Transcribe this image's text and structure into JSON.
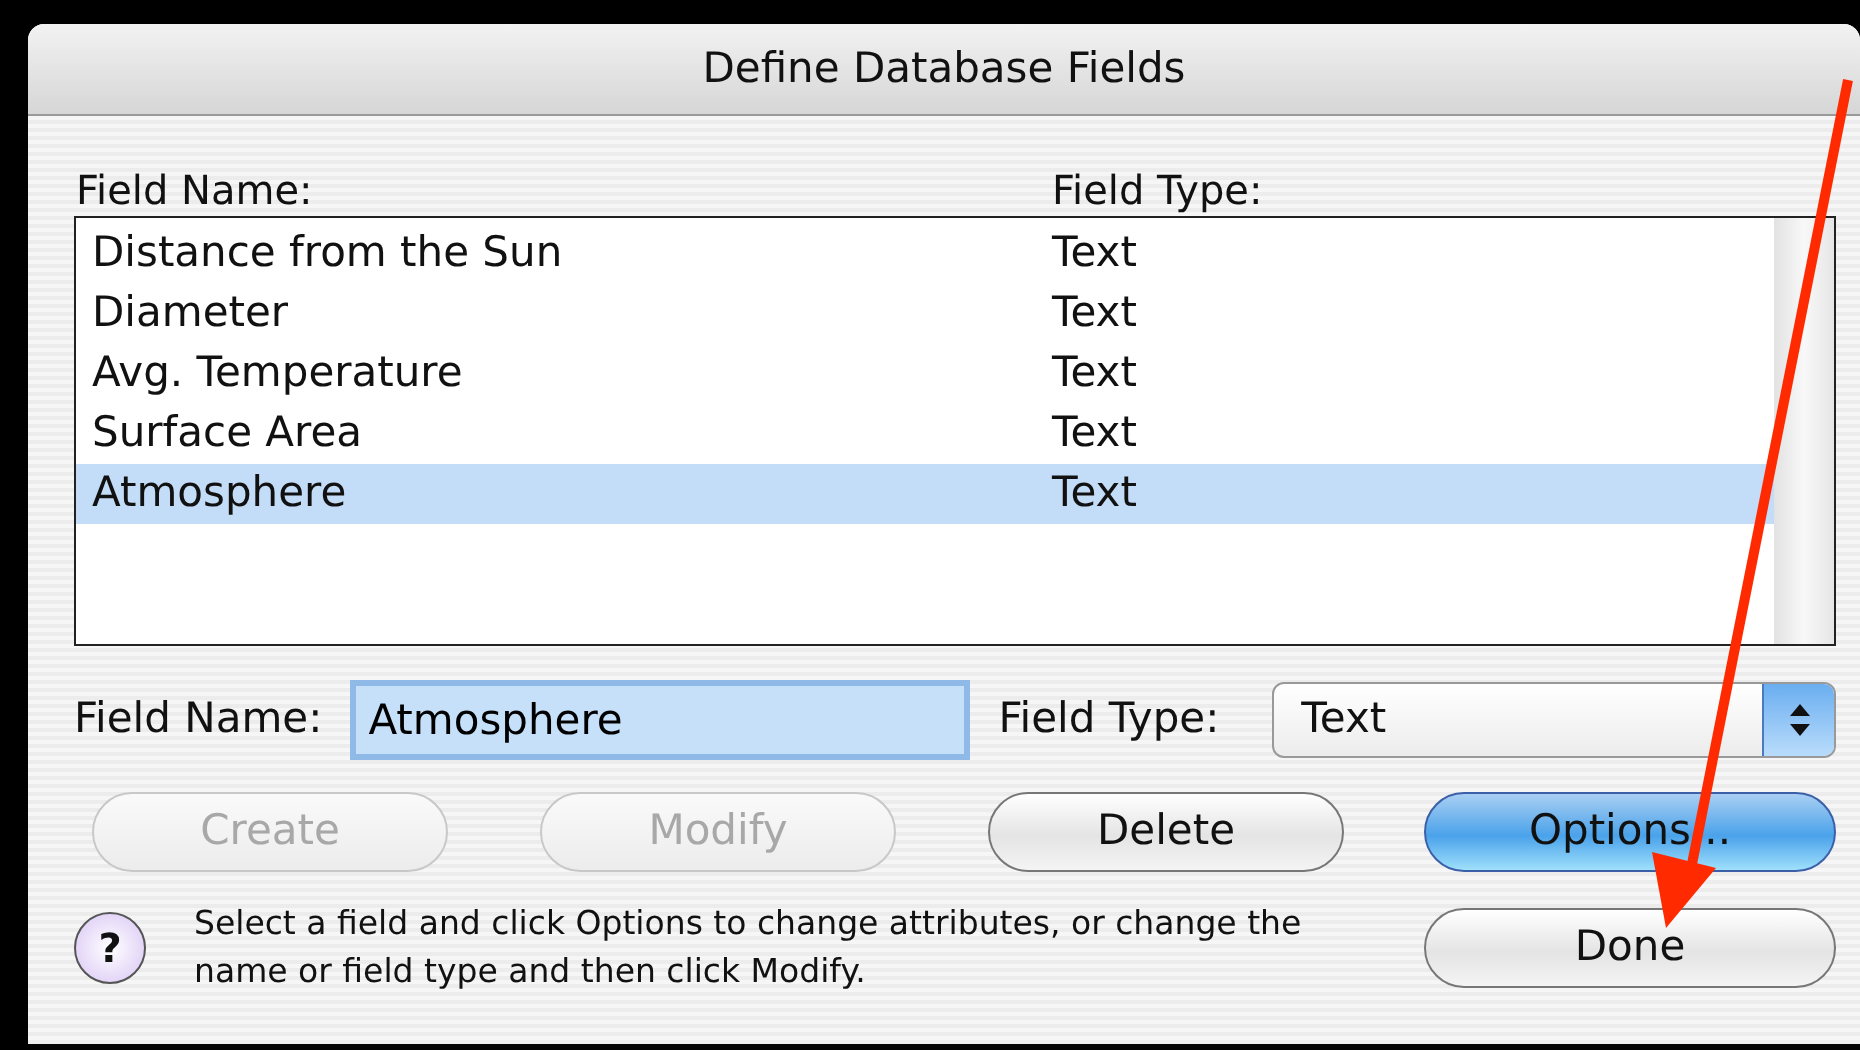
{
  "window": {
    "title": "Define Database Fields"
  },
  "list": {
    "columns": [
      "Field Name:",
      "Field Type:"
    ],
    "rows": [
      {
        "name": "Distance from the Sun",
        "type": "Text",
        "selected": false
      },
      {
        "name": "Diameter",
        "type": "Text",
        "selected": false
      },
      {
        "name": "Avg. Temperature",
        "type": "Text",
        "selected": false
      },
      {
        "name": "Surface Area",
        "type": "Text",
        "selected": false
      },
      {
        "name": "Atmosphere",
        "type": "Text",
        "selected": true
      }
    ]
  },
  "field_name": {
    "label": "Field Name:",
    "value": "Atmosphere"
  },
  "field_type": {
    "label": "Field Type:",
    "value": "Text"
  },
  "buttons": [
    {
      "label": "Create",
      "disabled": true,
      "default": false
    },
    {
      "label": "Modify",
      "disabled": true,
      "default": false
    },
    {
      "label": "Delete",
      "disabled": false,
      "default": false
    },
    {
      "label": "Options...",
      "disabled": false,
      "default": true
    }
  ],
  "help": {
    "icon": "?",
    "text": "Select a field and click Options to change attributes, or change the name or field type and then click Modify."
  },
  "done_button": {
    "label": "Done"
  },
  "annotation": {
    "kind": "arrow"
  }
}
